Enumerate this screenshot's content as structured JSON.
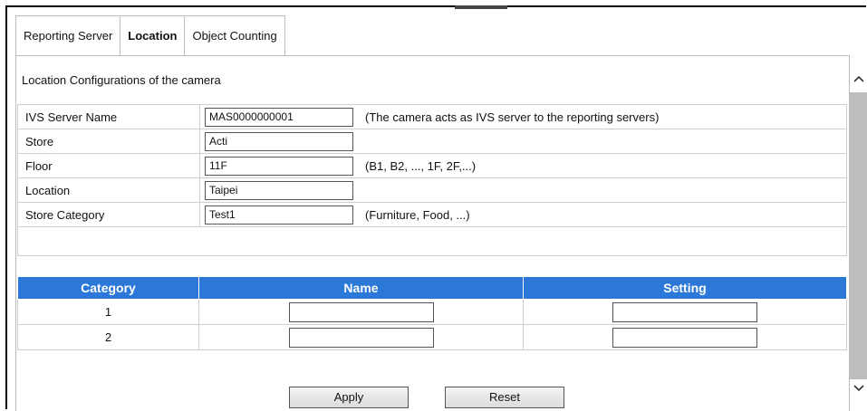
{
  "tabs": [
    {
      "label": "Reporting Server"
    },
    {
      "label": "Location"
    },
    {
      "label": "Object Counting"
    }
  ],
  "section_title": "Location Configurations of the camera",
  "fields": [
    {
      "label": "IVS Server Name",
      "value": "MAS0000000001",
      "hint": "(The camera acts as IVS server to the reporting servers)"
    },
    {
      "label": "Store",
      "value": "Acti",
      "hint": ""
    },
    {
      "label": "Floor",
      "value": "11F",
      "hint": "(B1, B2, ..., 1F, 2F,...)"
    },
    {
      "label": "Location",
      "value": "Taipei",
      "hint": ""
    },
    {
      "label": "Store Category",
      "value": "Test1",
      "hint": "(Furniture, Food, ...)"
    }
  ],
  "category_table": {
    "headers": [
      "Category",
      "Name",
      "Setting"
    ],
    "rows": [
      {
        "category": "1",
        "name": "",
        "setting": ""
      },
      {
        "category": "2",
        "name": "",
        "setting": ""
      }
    ]
  },
  "buttons": {
    "apply": "Apply",
    "reset": "Reset"
  },
  "colors": {
    "header_bg": "#2b78d8",
    "scroll_track": "#bdbdbd"
  },
  "icons": {
    "scroll_up": "chevron-up-icon",
    "scroll_down": "chevron-down-icon"
  }
}
